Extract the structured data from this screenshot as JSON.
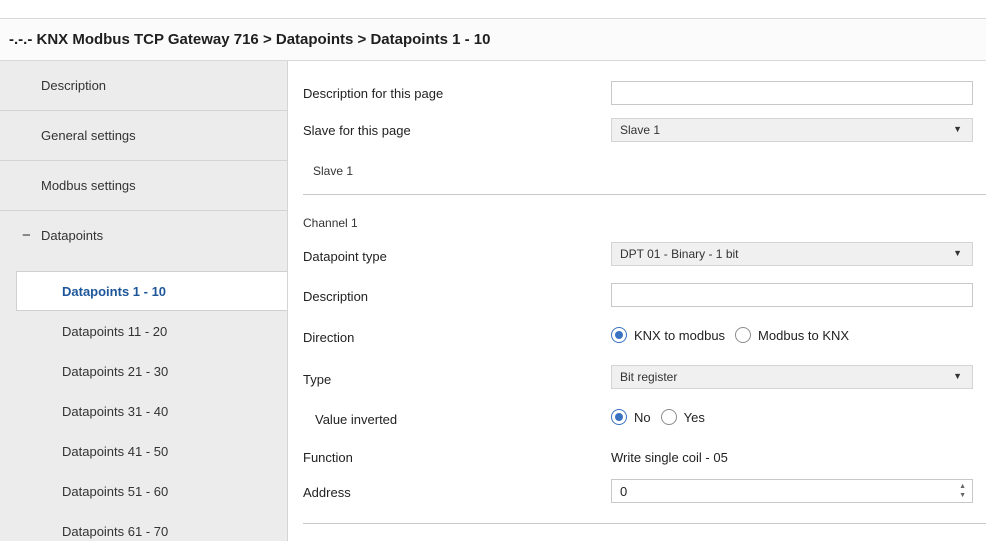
{
  "title": "-.-.- KNX Modbus TCP Gateway 716 > Datapoints > Datapoints 1 - 10",
  "sidebar": {
    "top_items": [
      {
        "label": "Description"
      },
      {
        "label": "General settings"
      },
      {
        "label": "Modbus settings"
      },
      {
        "label": "Datapoints",
        "expander": "−"
      }
    ],
    "sub_items": [
      {
        "label": "Datapoints 1 - 10"
      },
      {
        "label": "Datapoints 11 - 20"
      },
      {
        "label": "Datapoints 21 - 30"
      },
      {
        "label": "Datapoints 31 - 40"
      },
      {
        "label": "Datapoints 41 - 50"
      },
      {
        "label": "Datapoints 51 - 60"
      },
      {
        "label": "Datapoints 61 - 70"
      }
    ]
  },
  "main": {
    "page_description": {
      "label": "Description for this page",
      "value": ""
    },
    "slave": {
      "label": "Slave for this page",
      "value": "Slave 1",
      "subtext": "Slave 1"
    },
    "channel": {
      "title": "Channel 1",
      "datapoint_type": {
        "label": "Datapoint type",
        "value": "DPT 01 - Binary - 1 bit"
      },
      "description": {
        "label": "Description",
        "value": ""
      },
      "direction": {
        "label": "Direction",
        "options": [
          "KNX to modbus",
          "Modbus to KNX"
        ],
        "selected": "KNX to modbus"
      },
      "type": {
        "label": "Type",
        "value": "Bit register"
      },
      "value_inverted": {
        "label": "Value inverted",
        "options": [
          "No",
          "Yes"
        ],
        "selected": "No"
      },
      "function": {
        "label": "Function",
        "value": "Write single coil - 05"
      },
      "address": {
        "label": "Address",
        "value": "0"
      }
    }
  },
  "icons": {
    "dropdown": "caret-down-icon",
    "spinner": "spinner-arrows-icon",
    "expander": "minus-icon"
  },
  "colors": {
    "accent": "#1e5799",
    "radio": "#3a73c2",
    "sidebar_bg": "#ececec"
  }
}
